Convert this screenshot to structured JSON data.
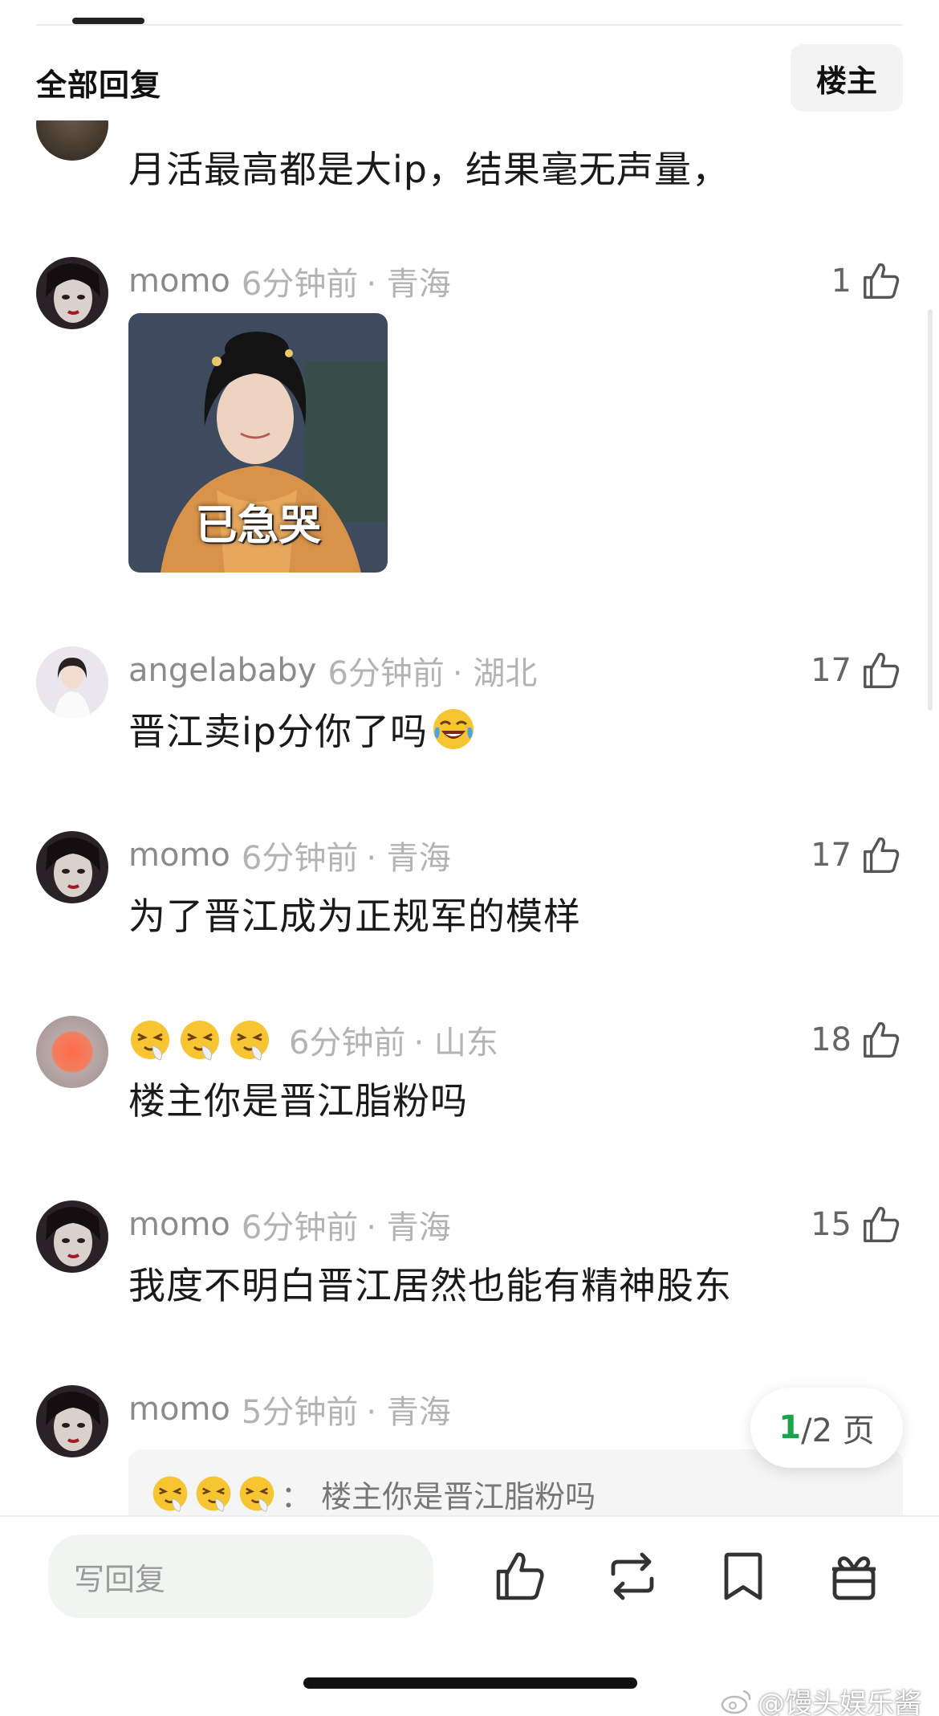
{
  "header": {
    "title": "全部回复",
    "op_label": "楼主"
  },
  "partial_comment": {
    "text": "月活最高都是大ip，结果毫无声量，"
  },
  "comments": [
    {
      "name": "momo",
      "time": "6分钟前",
      "loc": "· 青海",
      "likes": "1",
      "sticker_caption": "已急哭"
    },
    {
      "name": "angelababy",
      "time": "6分钟前",
      "loc": "· 湖北",
      "likes": "17",
      "text": "晋江卖ip分你了吗"
    },
    {
      "name": "momo",
      "time": "6分钟前",
      "loc": "· 青海",
      "likes": "17",
      "text": "为了晋江成为正规军的模样"
    },
    {
      "name": "",
      "time": "6分钟前",
      "loc": "· 山东",
      "likes": "18",
      "text": "楼主你是晋江脂粉吗"
    },
    {
      "name": "momo",
      "time": "6分钟前",
      "loc": "· 青海",
      "likes": "15",
      "text": "我度不明白晋江居然也能有精神股东"
    },
    {
      "name": "momo",
      "time": "5分钟前",
      "loc": "· 青海",
      "quote": "：  楼主你是晋江脂粉吗"
    }
  ],
  "pagination": {
    "current": "1",
    "rest": "/2 页"
  },
  "bottom_bar": {
    "reply_placeholder": "写回复"
  },
  "watermark": "@馒头娱乐酱",
  "icons": {
    "like": "thumbs-up-icon",
    "repost": "repost-icon",
    "bookmark": "bookmark-icon",
    "gift": "gift-icon",
    "weibo": "weibo-logo-icon"
  },
  "colors": {
    "accent_green": "#1aa34a",
    "meta_gray": "#8b8b8b"
  }
}
